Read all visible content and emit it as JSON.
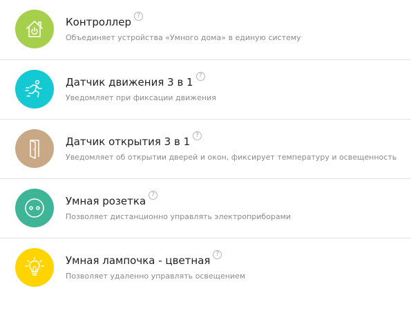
{
  "items": [
    {
      "title": "Контроллер",
      "description": "Объединяет устройства «Умного дома» в единую систему",
      "icon": "smart-home-power-icon",
      "color": "#a6cf4b",
      "help": "?"
    },
    {
      "title": "Датчик движения 3 в 1",
      "description": "Уведомляет при фиксации движения",
      "icon": "running-man-icon",
      "color": "#14c9d1",
      "help": "?"
    },
    {
      "title": "Датчик открытия 3 в 1",
      "description": "Уведомляет об открытии дверей и окон, фиксирует температуру и освещенность",
      "icon": "open-door-icon",
      "color": "#c9a886",
      "help": "?"
    },
    {
      "title": "Умная розетка",
      "description": "Позволяет дистанционно управлять электроприборами",
      "icon": "power-socket-icon",
      "color": "#3fb598",
      "help": "?"
    },
    {
      "title": "Умная лампочка - цветная",
      "description": "Позволяет удаленно управлять освещением",
      "icon": "light-bulb-icon",
      "color": "#ffd400",
      "help": "?"
    }
  ]
}
